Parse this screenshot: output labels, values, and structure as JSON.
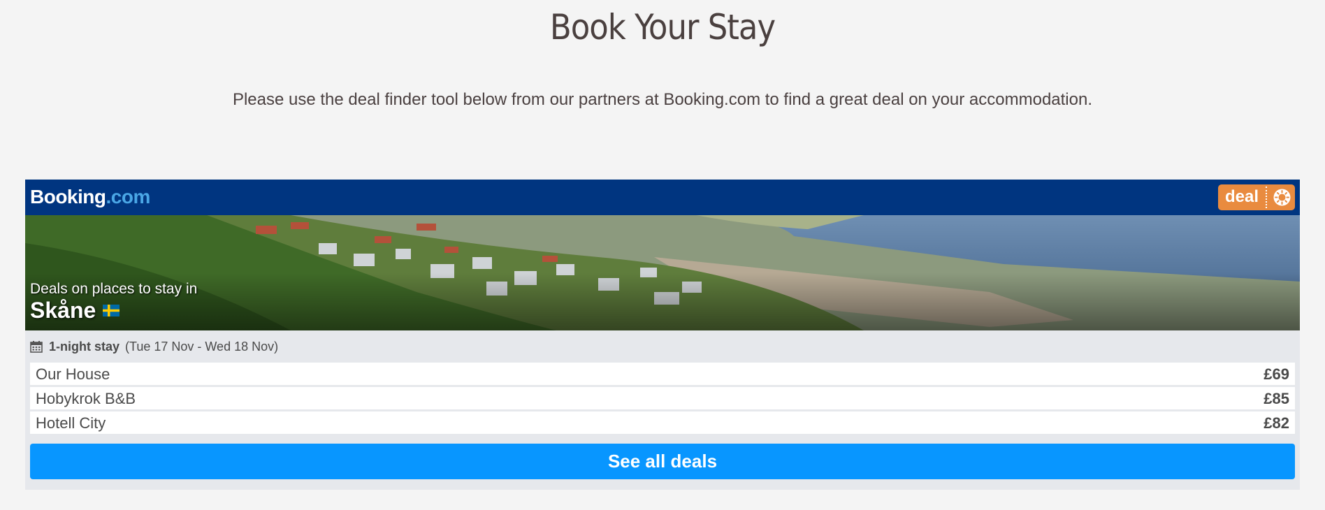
{
  "page": {
    "title": "Book Your Stay",
    "intro": "Please use the deal finder tool below from our partners at Booking.com to find a great deal on your accommodation."
  },
  "widget": {
    "logo_main": "Booking",
    "logo_suffix": ".com",
    "deal_badge": "deal",
    "hero_subtitle": "Deals on places to stay in",
    "hero_city": "Skåne",
    "flag_icon": "sweden-flag-icon",
    "stay_length": "1-night stay",
    "stay_dates": "(Tue 17 Nov - Wed 18 Nov)",
    "deals": [
      {
        "name": "Our House",
        "price": "£69"
      },
      {
        "name": "Hobykrok B&B",
        "price": "£85"
      },
      {
        "name": "Hotell City",
        "price": "£82"
      }
    ],
    "cta_label": "See all deals"
  },
  "colors": {
    "page_bg": "#f4f4f4",
    "booking_blue": "#003580",
    "booking_light_blue": "#4aa7e6",
    "deal_orange": "#e98b3f",
    "cta_blue": "#0896ff",
    "widget_bg": "#e6e8ec"
  }
}
